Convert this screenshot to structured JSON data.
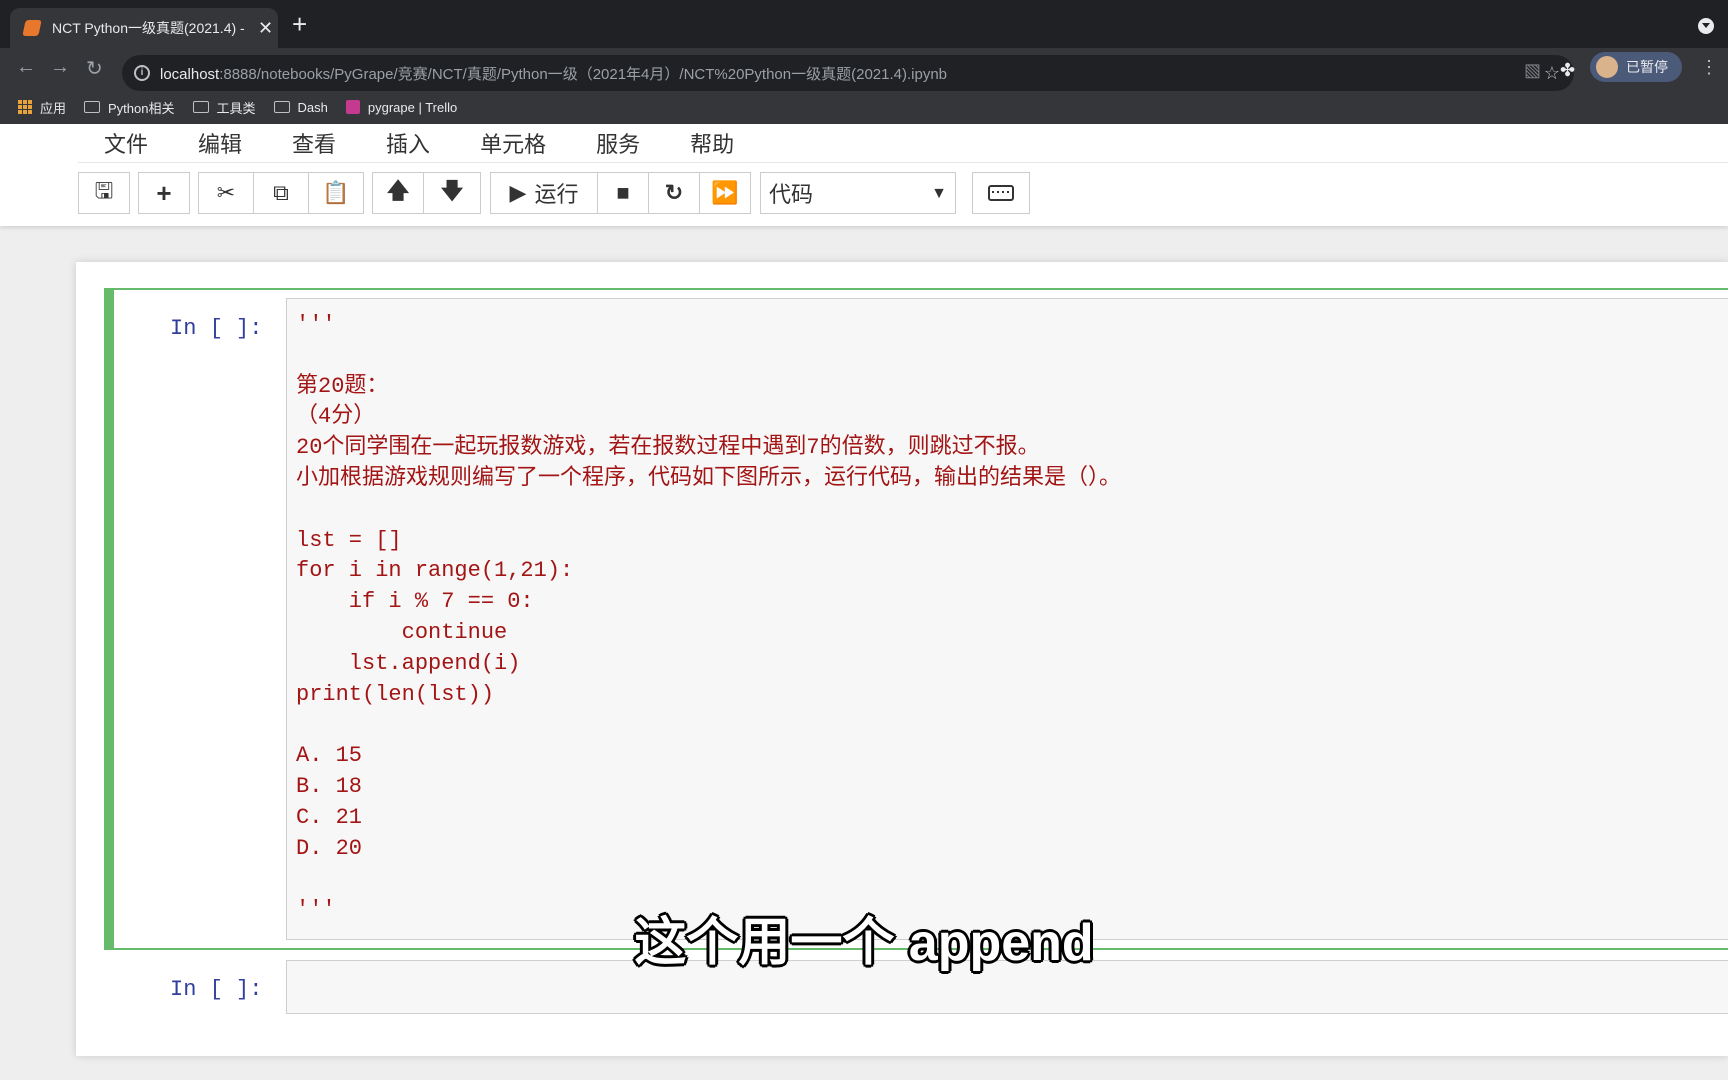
{
  "browser": {
    "tab_title": "NCT Python一级真题(2021.4) -",
    "close_glyph": "✕",
    "new_tab_glyph": "+",
    "url_host": "localhost",
    "url_rest": ":8888/notebooks/PyGrape/竞赛/NCT/真题/Python一级（2021年4月）/NCT%20Python一级真题(2021.4).ipynb",
    "profile_label": "已暂停",
    "bookmarks": [
      {
        "label": "应用",
        "icon": "apps-icon"
      },
      {
        "label": "Python相关",
        "icon": "folder-icon"
      },
      {
        "label": "工具类",
        "icon": "folder-icon"
      },
      {
        "label": "Dash",
        "icon": "folder-icon"
      },
      {
        "label": "pygrape | Trello",
        "icon": "trello-icon"
      }
    ]
  },
  "jupyter": {
    "menu": [
      "文件",
      "编辑",
      "查看",
      "插入",
      "单元格",
      "服务",
      "帮助"
    ],
    "toolbar": {
      "run_label": "运行",
      "cell_type": "代码"
    },
    "cells": [
      {
        "prompt": "In [ ]:",
        "code": "'''\n\n第20题：\n（4分）\n20个同学围在一起玩报数游戏，若在报数过程中遇到7的倍数，则跳过不报。\n小加根据游戏规则编写了一个程序，代码如下图所示，运行代码，输出的结果是（）。\n\nlst = []\nfor i in range(1,21):\n    if i % 7 == 0:\n        continue\n    lst.append(i)\nprint(len(lst))\n\nA. 15\nB. 18\nC. 21\nD. 20\n\n'''"
      },
      {
        "prompt": "In [ ]:",
        "code": ""
      }
    ]
  },
  "subtitle": "这个用一个 append"
}
